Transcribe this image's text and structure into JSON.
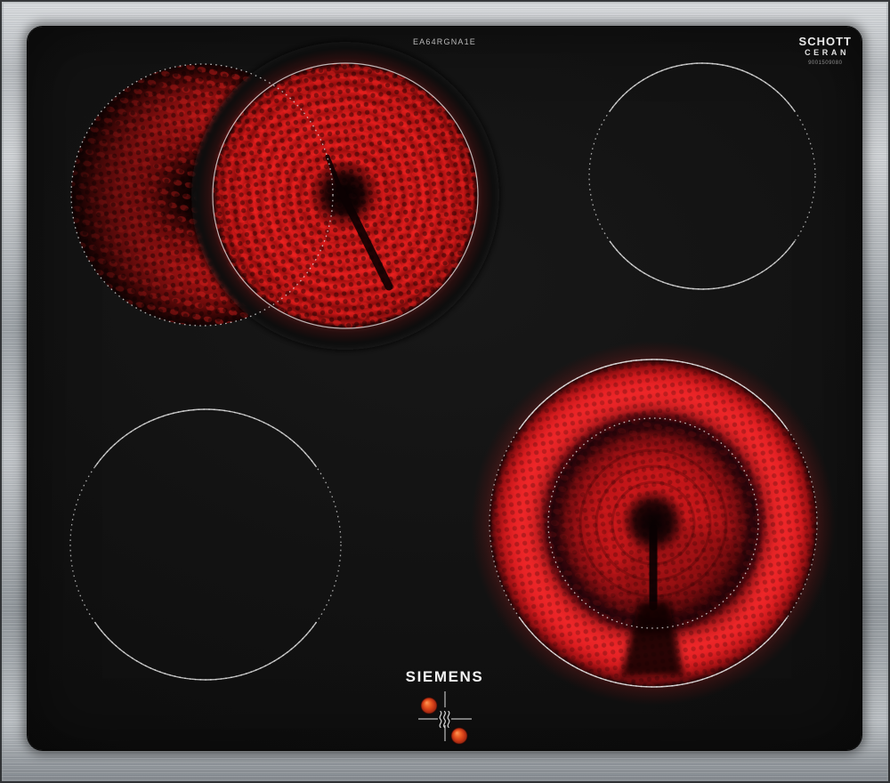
{
  "product": {
    "brand": "SIEMENS",
    "model_marking": "EA64RGNA1E"
  },
  "glass_logo": {
    "maker": "SCHOTT",
    "line": "CERAN",
    "code": "9001509080"
  },
  "zones": [
    {
      "position": "rear-left",
      "type": "dual-circuit",
      "state": "on"
    },
    {
      "position": "rear-right",
      "type": "single-circuit",
      "state": "off"
    },
    {
      "position": "front-left",
      "type": "single-circuit",
      "state": "off"
    },
    {
      "position": "front-right",
      "type": "dual-circuit",
      "state": "on"
    }
  ],
  "indicators": {
    "residual_heat_icon": "heat-waves",
    "hot_zone_dots": 2
  },
  "colors": {
    "steel_frame": "#b7bbbf",
    "glass_black": "#121212",
    "element_red": "#e01d1f",
    "deep_red": "#8a0e10",
    "marking_white": "#d0d0d0",
    "indicator_orange": "#e85a20",
    "brand_white": "#f4f4f4"
  }
}
